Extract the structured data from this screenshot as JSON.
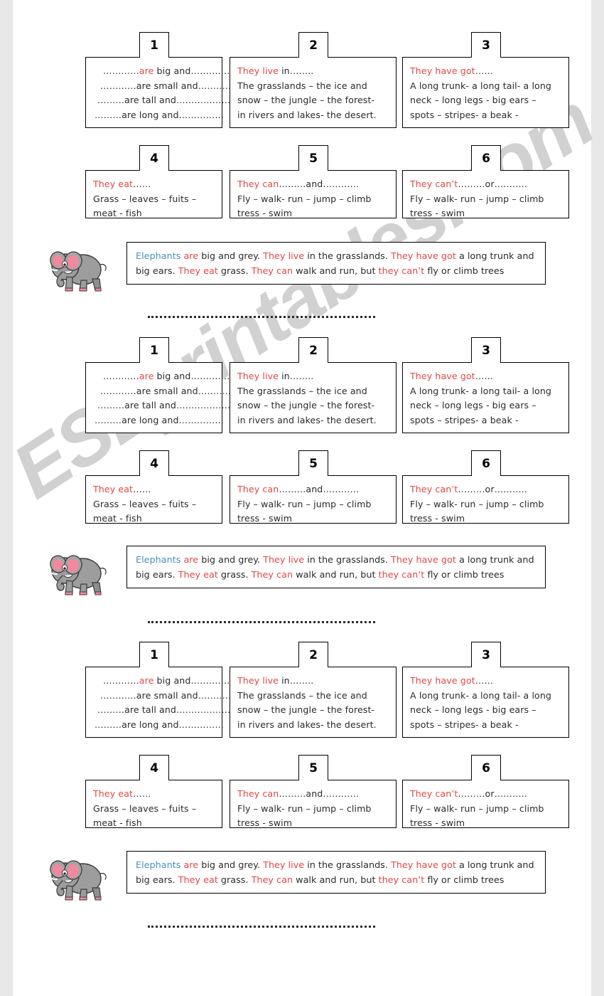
{
  "document": {
    "type": "esl-worksheet",
    "watermark": "ESLprintables.com",
    "colors": {
      "prompt_accent": "#e04848",
      "subject_accent": "#4a90c2",
      "ink": "#2b2b2b",
      "border": "#000000",
      "watermark": "#c9c9c9",
      "elephant_body": "#9d9d9d",
      "elephant_ear": "#f2889b"
    }
  },
  "cards": [
    {
      "number": "1",
      "lines": [
        {
          "dots_before": "…………",
          "prompt": "are",
          "rest": " big and………………",
          "prompt_colored": true
        },
        {
          "dots_before": "…………",
          "prompt": "are",
          "rest": " small and……………",
          "prompt_colored": false
        },
        {
          "dots_before": "………",
          "prompt": "are",
          "rest": " tall and………………",
          "prompt_colored": false
        },
        {
          "dots_before": "………",
          "prompt": "are",
          "rest": " long and……………",
          "prompt_colored": false
        }
      ]
    },
    {
      "number": "2",
      "header": "They live",
      "header_rest": " in……..",
      "lines": [
        "The grasslands – the ice and",
        "snow – the jungle – the forest-",
        "in rivers and lakes- the desert."
      ]
    },
    {
      "number": "3",
      "header": "They have got",
      "header_rest": "……",
      "lines": [
        "A long trunk- a long tail-  a long",
        "neck – long legs - big ears –",
        "spots – stripes- a beak -"
      ]
    },
    {
      "number": "4",
      "header": "They eat",
      "header_rest": "……",
      "lines": [
        "Grass – leaves – fuits –",
        "meat - fish"
      ]
    },
    {
      "number": "5",
      "header": "They can",
      "header_rest": "………and…………",
      "lines": [
        "Fly – walk- run – jump – climb",
        "tress - swim"
      ]
    },
    {
      "number": "6",
      "header": "They can’t",
      "header_rest": "………or………..",
      "lines": [
        "Fly – walk- run – jump – climb",
        "tress - swim"
      ]
    }
  ],
  "summary": {
    "line1": [
      {
        "text": "Elephants",
        "color": "blue"
      },
      {
        "text": " ",
        "color": "plain"
      },
      {
        "text": "are",
        "color": "red"
      },
      {
        "text": " big and grey. ",
        "color": "plain"
      },
      {
        "text": "They live",
        "color": "red"
      },
      {
        "text": " in the grasslands. ",
        "color": "plain"
      },
      {
        "text": "They have got",
        "color": "red"
      },
      {
        "text": " a long trunk and",
        "color": "plain"
      }
    ],
    "line2": [
      {
        "text": "big ears. ",
        "color": "plain"
      },
      {
        "text": "They eat",
        "color": "red"
      },
      {
        "text": " grass. ",
        "color": "plain"
      },
      {
        "text": "They can",
        "color": "red"
      },
      {
        "text": " walk and run, but ",
        "color": "plain"
      },
      {
        "text": "they can’t",
        "color": "red"
      },
      {
        "text": " fly or climb trees",
        "color": "plain"
      }
    ],
    "plain_text": "Elephants are big and grey. They live in the grasslands. They have got a long trunk and big ears. They eat grass. They can walk and run, but they can’t fly or climb trees"
  },
  "icons": {
    "elephant": "elephant-icon"
  },
  "sections": [
    {
      "id": "section-1",
      "label": "worksheet-copy-1"
    },
    {
      "id": "section-2",
      "label": "worksheet-copy-2"
    },
    {
      "id": "section-3",
      "label": "worksheet-copy-3"
    }
  ]
}
